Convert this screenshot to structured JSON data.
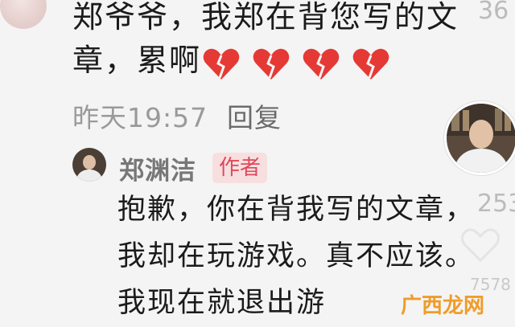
{
  "comment1": {
    "text": "郑爷爷，我郑在背您写的文章，累啊",
    "hearts": [
      "broken-heart",
      "broken-heart",
      "broken-heart",
      "broken-heart"
    ],
    "time": "昨天19:57",
    "reply_label": "回复",
    "like_count_partial": "36"
  },
  "reply1": {
    "author": "郑渊洁",
    "badge": "作者",
    "text": "抱歉，你在背我写的文章，我却在玩游戏。真不应该。我现在就退出游",
    "like_count_partial": "253",
    "faint_count": "7578"
  },
  "watermark": {
    "text": "广西龙网"
  },
  "colors": {
    "badge_bg": "#f7dfe0",
    "badge_text": "#e0485b",
    "heart": "#e53935",
    "meta": "#9a9a9a"
  }
}
